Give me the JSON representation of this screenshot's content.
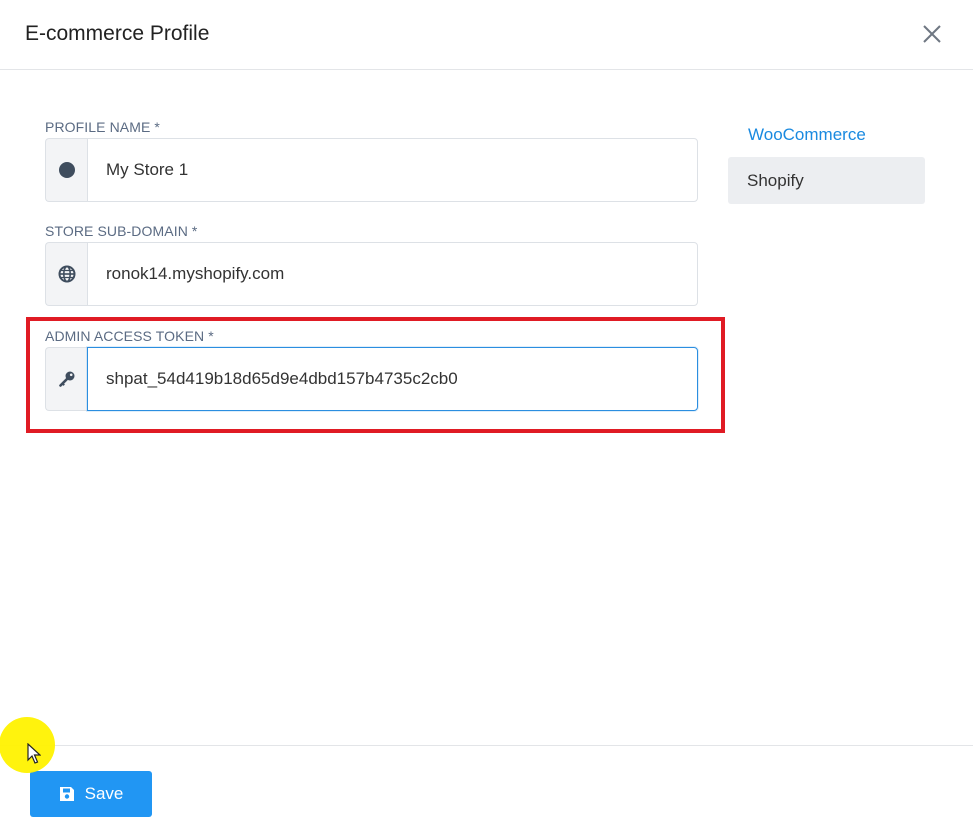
{
  "dialog": {
    "title": "E-commerce Profile"
  },
  "form": {
    "profile_name": {
      "label": "PROFILE NAME *",
      "value": "My Store 1",
      "icon": "circle-icon"
    },
    "store_subdomain": {
      "label": "STORE SUB-DOMAIN *",
      "value": "ronok14.myshopify.com",
      "icon": "globe-icon"
    },
    "admin_token": {
      "label": "ADMIN ACCESS TOKEN *",
      "value": "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",
      "icon": "key-icon"
    }
  },
  "platforms": {
    "items": [
      {
        "label": "WooCommerce",
        "selected": false
      },
      {
        "label": "Shopify",
        "selected": true
      }
    ]
  },
  "footer": {
    "save_label": "Save",
    "save_icon": "floppy-disk-icon"
  },
  "colors": {
    "accent": "#2196f3",
    "link": "#1a8ae0",
    "highlight": "#e01b24"
  }
}
